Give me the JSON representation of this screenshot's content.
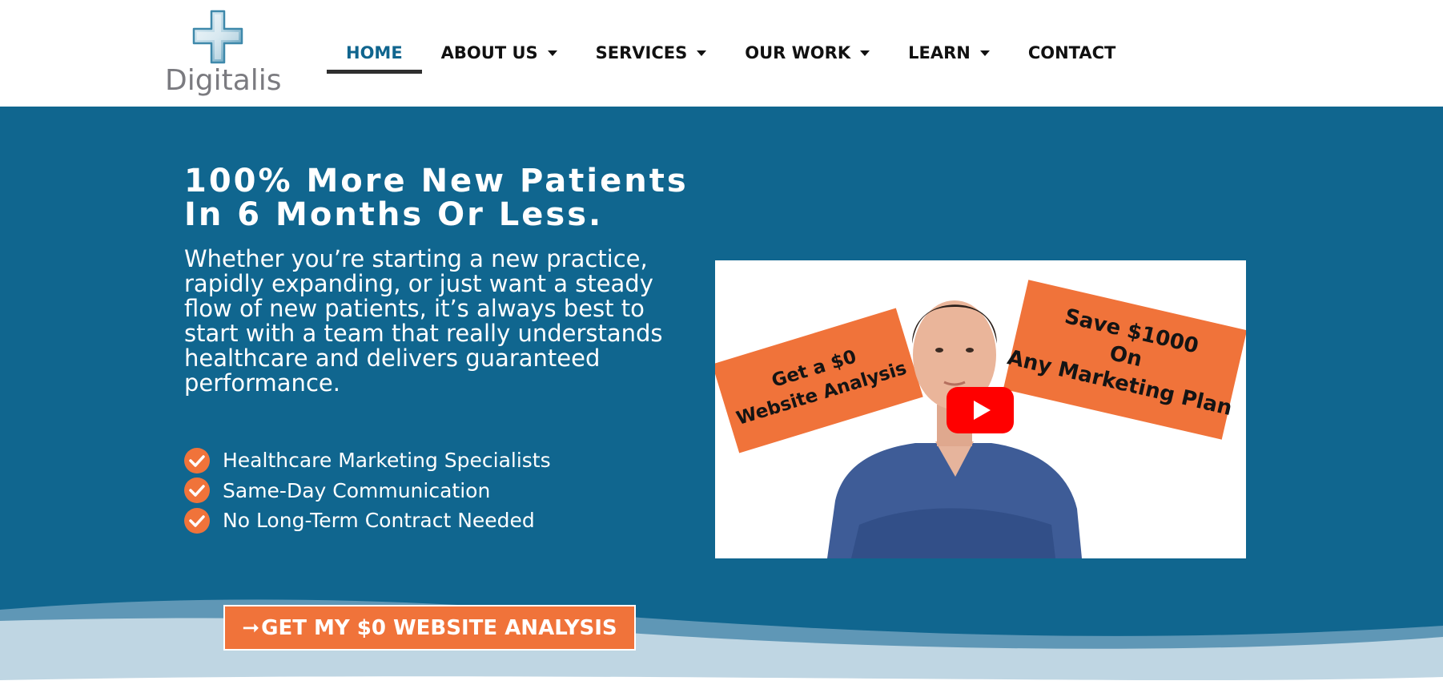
{
  "brand": {
    "name": "Digitalis",
    "colors": {
      "primary": "#10668f",
      "accent": "#f0733a",
      "nav_text": "#111111",
      "nav_active": "#10658e"
    }
  },
  "nav": {
    "items": [
      {
        "label": "HOME",
        "active": true,
        "has_dropdown": false
      },
      {
        "label": "ABOUT US",
        "active": false,
        "has_dropdown": true
      },
      {
        "label": "SERVICES",
        "active": false,
        "has_dropdown": true
      },
      {
        "label": "OUR WORK",
        "active": false,
        "has_dropdown": true
      },
      {
        "label": "LEARN",
        "active": false,
        "has_dropdown": true
      },
      {
        "label": "CONTACT",
        "active": false,
        "has_dropdown": false
      }
    ]
  },
  "hero": {
    "headline_line1": "100% More New Patients",
    "headline_line2": "In 6 Months Or Less.",
    "intro": "Whether you’re starting a new practice, rapidly expanding, or just want a steady flow of new patients, it’s always best to start with a team that really understands healthcare and delivers guaranteed performance.",
    "checklist": [
      "Healthcare Marketing Specialists",
      "Same-Day Communication",
      "No Long-Term Contract Needed"
    ],
    "cta_arrow": "➞",
    "cta_label": "GET MY $0 WEBSITE ANALYSIS"
  },
  "video": {
    "sign_left_line1": "Get a $0",
    "sign_left_line2": "Website Analysis",
    "sign_right_line1": "Save $1000",
    "sign_right_line2": "On",
    "sign_right_line3": "Any Marketing Plan",
    "play_icon": "youtube-play-icon"
  }
}
